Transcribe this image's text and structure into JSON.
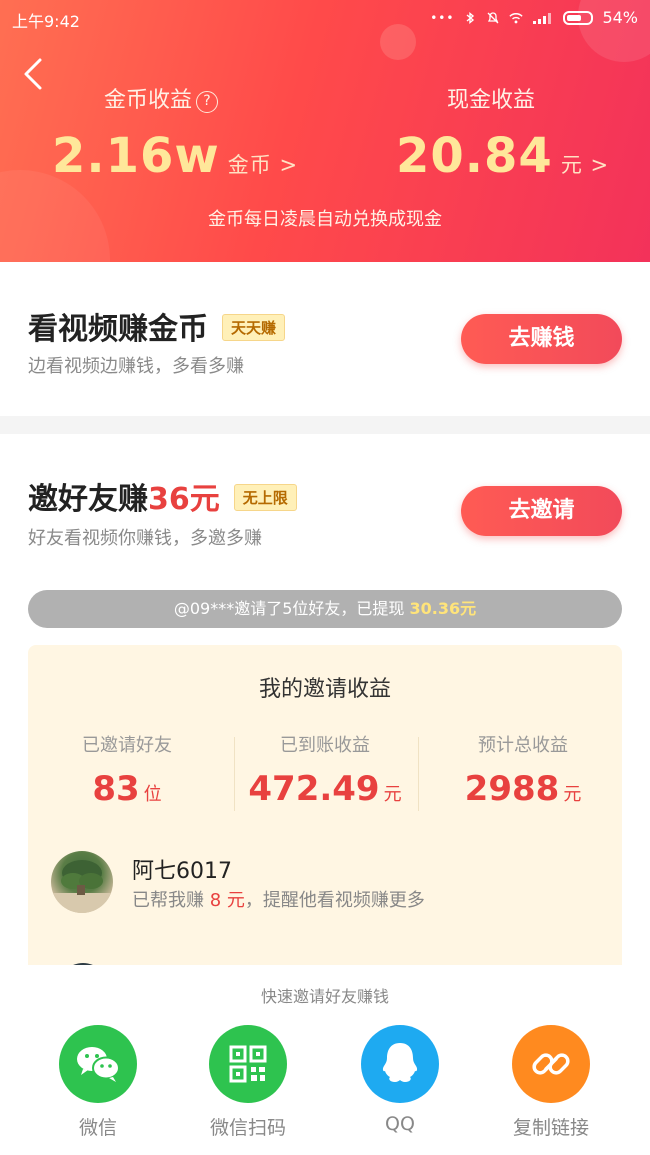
{
  "status_bar": {
    "time": "上午9:42",
    "battery": "54%"
  },
  "header": {
    "coin_label": "金币收益",
    "coin_value": "2.16w",
    "coin_unit": "金币 >",
    "cash_label": "现金收益",
    "cash_value": "20.84",
    "cash_unit": "元 >",
    "note": "金币每日凌晨自动兑换成现金"
  },
  "video_task": {
    "title": "看视频赚金币",
    "tag": "天天赚",
    "subtitle": "边看视频边赚钱，多看多赚",
    "button": "去赚钱"
  },
  "invite_task": {
    "title": "邀好友赚",
    "amount": "36元",
    "tag": "无上限",
    "subtitle": "好友看视频你赚钱，多邀多赚",
    "button": "去邀请"
  },
  "ticker": {
    "text": "@09***邀请了5位好友，已提现 ",
    "amount": "30.36元"
  },
  "earnings": {
    "title": "我的邀请收益",
    "stats": [
      {
        "label": "已邀请好友",
        "value": "83",
        "unit": "位"
      },
      {
        "label": "已到账收益",
        "value": "472.49",
        "unit": "元"
      },
      {
        "label": "预计总收益",
        "value": "2988",
        "unit": "元"
      }
    ],
    "friend": {
      "name": "阿七6017",
      "desc_prefix": "已帮我赚 ",
      "desc_amount": "8 元",
      "desc_suffix": "，提醒他看视频赚更多"
    }
  },
  "share": {
    "title": "快速邀请好友赚钱",
    "items": [
      {
        "label": "微信",
        "icon": "wechat-icon",
        "color": "#2ec34f"
      },
      {
        "label": "微信扫码",
        "icon": "qrcode-icon",
        "color": "#2ec34f"
      },
      {
        "label": "QQ",
        "icon": "qq-icon",
        "color": "#1eaaf1"
      },
      {
        "label": "复制链接",
        "icon": "link-icon",
        "color": "#ff8a1f"
      }
    ]
  }
}
